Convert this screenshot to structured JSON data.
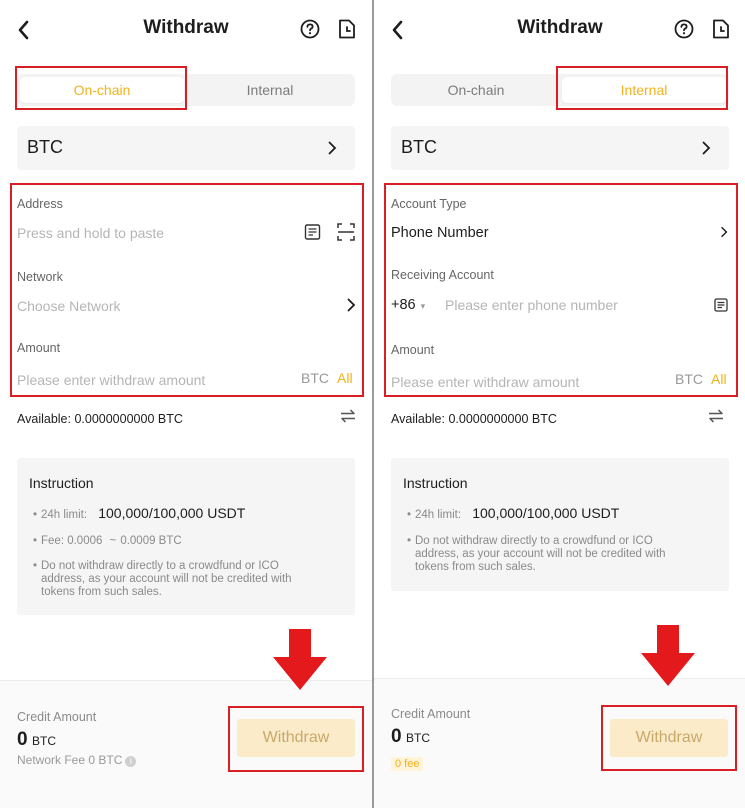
{
  "left": {
    "title": "Withdraw",
    "tabs": [
      {
        "label": "On-chain",
        "active": true
      },
      {
        "label": "Internal",
        "active": false
      }
    ],
    "coin": "BTC",
    "address": {
      "label": "Address",
      "placeholder": "Press and hold to paste"
    },
    "network": {
      "label": "Network",
      "placeholder": "Choose Network"
    },
    "amount": {
      "label": "Amount",
      "placeholder": "Please enter withdraw amount",
      "unit": "BTC",
      "all": "All"
    },
    "available": "Available: 0.0000000000 BTC",
    "instruction": {
      "title": "Instruction",
      "limit_label": "24h limit:",
      "limit_value": "100,000/100,000 USDT",
      "fee_label": "Fee: 0.0006",
      "fee_tilde": "~",
      "fee_max": "0.0009 BTC",
      "warning_lines": [
        "Do not withdraw directly to a crowdfund or ICO",
        "address, as your account will not be credited with",
        "tokens from such sales."
      ]
    },
    "credit": {
      "label": "Credit Amount",
      "value": "0",
      "unit": "BTC",
      "fee_note": "Network Fee 0 BTC"
    },
    "withdraw_button": "Withdraw"
  },
  "right": {
    "title": "Withdraw",
    "tabs": [
      {
        "label": "On-chain",
        "active": false
      },
      {
        "label": "Internal",
        "active": true
      }
    ],
    "coin": "BTC",
    "account_type": {
      "label": "Account Type",
      "value": "Phone Number"
    },
    "receiving": {
      "label": "Receiving Account",
      "country_code": "+86",
      "placeholder": "Please enter phone number"
    },
    "amount": {
      "label": "Amount",
      "placeholder": "Please enter withdraw amount",
      "unit": "BTC",
      "all": "All"
    },
    "available": "Available: 0.0000000000 BTC",
    "instruction": {
      "title": "Instruction",
      "limit_label": "24h limit:",
      "limit_value": "100,000/100,000 USDT",
      "warning_lines": [
        "Do not withdraw directly to a crowdfund or ICO",
        "address, as your account will not be credited with",
        "tokens from such sales."
      ]
    },
    "credit": {
      "label": "Credit Amount",
      "value": "0",
      "unit": "BTC",
      "fee_badge": "0 fee"
    },
    "withdraw_button": "Withdraw"
  },
  "colors": {
    "accent": "#f2b21c",
    "highlight_box": "#d81f26",
    "arrow": "#e3191c",
    "button_bg": "#fbebc9"
  },
  "icons": [
    "back-arrow-icon",
    "help-circle-icon",
    "document-history-icon",
    "chevron-right-icon",
    "paste-icon",
    "scan-icon",
    "swap-icon",
    "info-icon",
    "phone-book-icon",
    "down-arrow-icon"
  ]
}
